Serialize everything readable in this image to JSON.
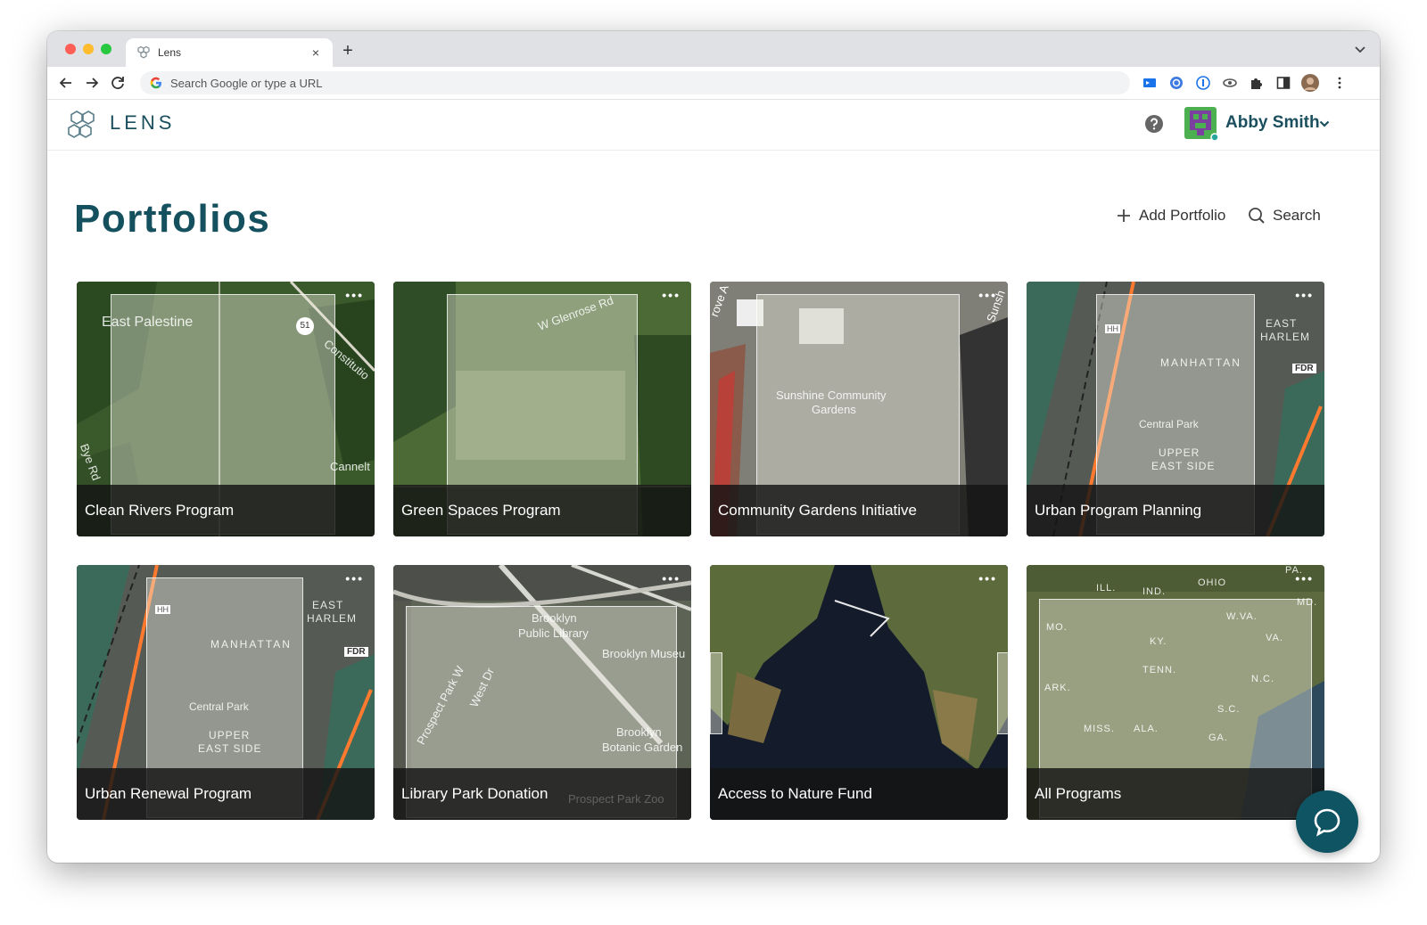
{
  "browser": {
    "tab_title": "Lens",
    "tab_close": "×",
    "new_tab": "+",
    "omnibox_placeholder": "Search Google or type a URL"
  },
  "header": {
    "logo_text": "LENS",
    "user_name": "Abby Smith"
  },
  "page": {
    "title": "Portfolios",
    "add_label": "Add Portfolio",
    "search_label": "Search"
  },
  "cards": [
    {
      "title": "Clean Rivers Program",
      "labels": [
        "East Palestine",
        "51",
        "Constitutio",
        "Cannelt",
        "Bye Rd"
      ]
    },
    {
      "title": "Green Spaces Program",
      "labels": [
        "W Glenrose Rd"
      ]
    },
    {
      "title": "Community Gardens Initiative",
      "labels": [
        "Sunshine Community",
        "Gardens",
        "rove A",
        "Sunsh"
      ]
    },
    {
      "title": "Urban Program Planning",
      "labels": [
        "EAST",
        "HARLEM",
        "MANHATTAN",
        "FDR",
        "HH",
        "Central Park",
        "UPPER",
        "EAST SIDE"
      ]
    },
    {
      "title": "Urban Renewal Program",
      "labels": [
        "EAST",
        "HARLEM",
        "MANHATTAN",
        "FDR",
        "HH",
        "Central Park",
        "UPPER",
        "EAST SIDE"
      ]
    },
    {
      "title": "Library Park Donation",
      "labels": [
        "Brooklyn",
        "Public Library",
        "Brooklyn Museu",
        "Prospect Park W",
        "West Dr",
        "Brooklyn",
        "Botanic Garden",
        "Prospect Park Zoo"
      ]
    },
    {
      "title": "Access to Nature Fund",
      "labels": []
    },
    {
      "title": "All Programs",
      "labels": [
        "ILL.",
        "IND.",
        "OHIO",
        "PA.",
        "MD.",
        "W.VA.",
        "VA.",
        "MO.",
        "KY.",
        "TENN.",
        "N.C.",
        "ARK.",
        "S.C.",
        "MISS.",
        "ALA.",
        "GA."
      ]
    }
  ],
  "colors": {
    "brand": "#14505e",
    "chat_button": "#0f5462"
  }
}
